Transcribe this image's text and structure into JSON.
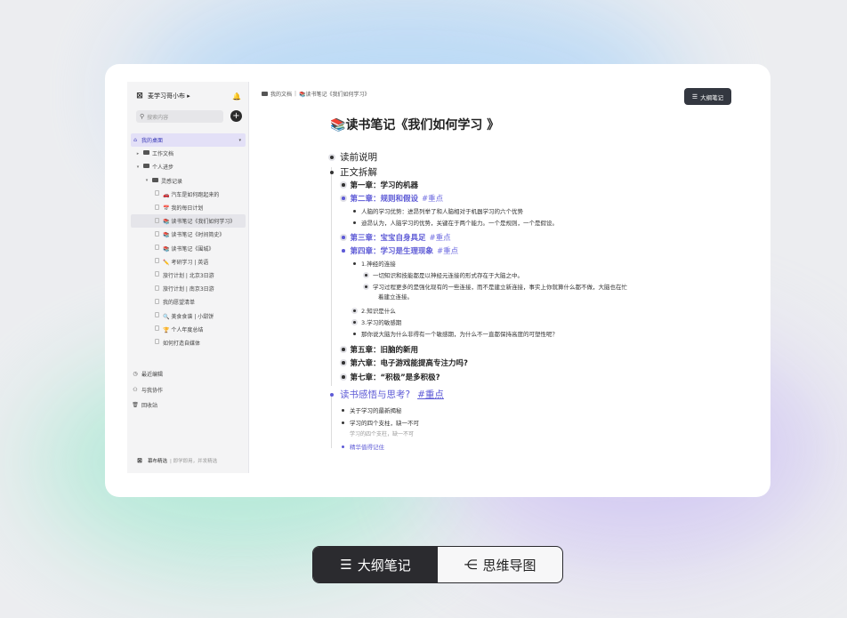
{
  "sidebar": {
    "workspace": "麦学习哥小布",
    "search_placeholder": "搜索内容",
    "items": [
      {
        "label": "我的桌面",
        "icon": "home-icon"
      },
      {
        "label": "工作文档",
        "icon": "folder-icon"
      },
      {
        "label": "个人进步",
        "icon": "folder-icon"
      },
      {
        "label": "灵感记录",
        "icon": "folder-icon"
      },
      {
        "label": "汽车是如何跑起来的",
        "emoji": "🚗"
      },
      {
        "label": "我的每日计划",
        "emoji": "📅"
      },
      {
        "label": "读书笔记《我们如何学习》",
        "emoji": "📚"
      },
      {
        "label": "读书笔记《时间简史》",
        "emoji": "📚"
      },
      {
        "label": "读书笔记《围城》",
        "emoji": "📚"
      },
      {
        "label": "考研学习 | 英语",
        "emoji": "✏️"
      },
      {
        "label": "旅行计划 | 北京3日游",
        "emoji": ""
      },
      {
        "label": "旅行计划 | 南京3日游",
        "emoji": ""
      },
      {
        "label": "我的愿望清单",
        "emoji": ""
      },
      {
        "label": "美食食谱 | 小甜饼",
        "emoji": "🔍"
      },
      {
        "label": "个人年度总结",
        "emoji": "🏆"
      },
      {
        "label": "如何打造自媒体",
        "emoji": ""
      }
    ],
    "bottom": [
      {
        "label": "最近编辑",
        "icon": "clock-icon"
      },
      {
        "label": "与我协作",
        "icon": "collab-icon"
      },
      {
        "label": "回收站",
        "icon": "trash-icon"
      }
    ],
    "footer_brand": "幕布精选",
    "footer_tag": "即学即用，并发精选"
  },
  "breadcrumb": {
    "root": "我的文档",
    "current": "读书笔记《我们如何学习》"
  },
  "outline_button": "大纲笔记",
  "doc": {
    "emoji": "📚",
    "title": "读书笔记《我们如何学习 》",
    "n0": "读前说明",
    "n1": "正文拆解",
    "ch1": "第一章：学习的机器",
    "ch2": "第二章：规则和假设",
    "ch2_tag": "#重点",
    "ch2_a": "人脑的学习优势：进昂列举了和人脑相对于机器学习的六个优势",
    "ch2_b": "迪昂认为，人脑学习的优势，关键在于两个能力。一个是规则，一个是假设。",
    "ch3": "第三章：宝宝自身具足",
    "ch3_tag": "#重点",
    "ch4": "第四章：学习是生理现象",
    "ch4_tag": "#重点",
    "ch4_a": "1.神经的连接",
    "ch4_a1": "一切知识和技能都是以神经元连接的形式存在于大脑之中。",
    "ch4_a2_l1": "学习过程更多的是强化现有的一些连接，而不是建立新连接，事实上你就算什么都不做，大脑也在忙",
    "ch4_a2_l2": "着建立连接。",
    "ch4_b": "2.知识是什么",
    "ch4_c": "3.学习的敏感期",
    "ch4_d": "那你说大脑为什么非得有一个敏感期，为什么不一直都保持高度的可塑性呢？",
    "ch5": "第五章：旧脑的新用",
    "ch6": "第六章：电子游戏能提高专注力吗?",
    "ch7": "第七章：“积极”是多积极?",
    "n2": "读书感悟与思考?",
    "n2_tag": "#重点",
    "n2_a": "关于学习的最新揭秘",
    "n2_b": "学习的四个支柱，缺一不可",
    "n2_b_note": "学习的四个支柱，缺一不可",
    "n2_c": "精华值得记住"
  },
  "switcher": {
    "outline": "大纲笔记",
    "mindmap": "思维导图"
  },
  "colors": {
    "accent": "#5d5ad6",
    "dark": "#2b2b2f"
  }
}
